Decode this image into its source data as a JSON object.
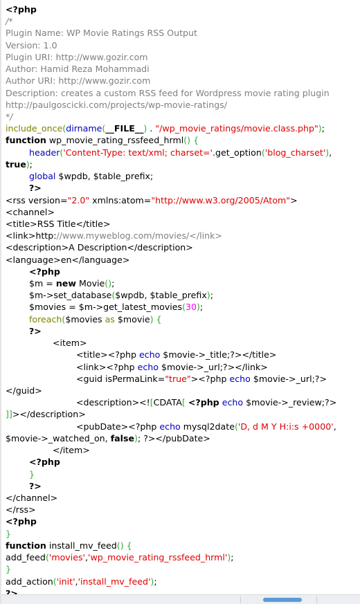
{
  "viewer": {
    "language": "php",
    "accent_color": "#5a9bd8",
    "background_color": "#ffffff",
    "scrollbar": {
      "orientation": "horizontal",
      "thumb_color": "#5a9bd8",
      "track_color": "#eceef1"
    }
  },
  "palette": {
    "default": "#000000",
    "comment": "#808080",
    "string": "#dd0000",
    "keyword": "#000000",
    "keyword_control": "#808000",
    "function": "#0000bb",
    "bracket": "#33aa33",
    "number": "#ff00ff"
  },
  "code": {
    "lines": [
      {
        "id": 1,
        "indent": 0,
        "tokens": [
          {
            "t": "<?php",
            "c": "kw"
          }
        ]
      },
      {
        "id": 2,
        "indent": 0,
        "tokens": [
          {
            "t": "/*",
            "c": "cmt-i"
          }
        ]
      },
      {
        "id": 3,
        "indent": 0,
        "tokens": [
          {
            "t": "Plugin Name: WP Movie Ratings RSS Output",
            "c": "cmt"
          }
        ]
      },
      {
        "id": 4,
        "indent": 0,
        "tokens": [
          {
            "t": "Version: 1.0",
            "c": "cmt"
          }
        ]
      },
      {
        "id": 5,
        "indent": 0,
        "tokens": [
          {
            "t": "Plugin URI: http://www.gozir.com",
            "c": "cmt"
          }
        ]
      },
      {
        "id": 6,
        "indent": 0,
        "tokens": [
          {
            "t": "Author: Hamid Reza Mohammadi",
            "c": "cmt"
          }
        ]
      },
      {
        "id": 7,
        "indent": 0,
        "tokens": [
          {
            "t": "Author URI: http://www.gozir.com",
            "c": "cmt"
          }
        ]
      },
      {
        "id": 8,
        "indent": 0,
        "tokens": [
          {
            "t": "Description: creates a custom RSS feed for Wordpress movie rating plugin",
            "c": "cmt"
          }
        ]
      },
      {
        "id": 9,
        "indent": 0,
        "tokens": [
          {
            "t": "http://paulgoscicki.com/projects/wp-movie-ratings/",
            "c": "cmt"
          }
        ]
      },
      {
        "id": 10,
        "indent": 0,
        "tokens": [
          {
            "t": "*/",
            "c": "cmt-i"
          }
        ]
      },
      {
        "id": 11,
        "indent": 0,
        "tokens": [
          {
            "t": "include_once",
            "c": "kw2"
          },
          {
            "t": "(",
            "c": "brk"
          },
          {
            "t": "dirname",
            "c": "fn"
          },
          {
            "t": "(",
            "c": "brk"
          },
          {
            "t": "__FILE__",
            "c": "kw"
          },
          {
            "t": ")",
            "c": "brk"
          },
          {
            "t": " . ",
            "c": "def"
          },
          {
            "t": "\"/wp_movie_ratings/movie.class.php\"",
            "c": "str"
          },
          {
            "t": ")",
            "c": "brk"
          },
          {
            "t": ";",
            "c": "def"
          }
        ]
      },
      {
        "id": 12,
        "indent": 0,
        "tokens": [
          {
            "t": "function",
            "c": "kw"
          },
          {
            "t": " wp_movie_rating_rssfeed_hrml",
            "c": "def"
          },
          {
            "t": "()",
            "c": "brk"
          },
          {
            "t": " ",
            "c": "def"
          },
          {
            "t": "{",
            "c": "brk"
          }
        ]
      },
      {
        "id": 13,
        "indent": 1,
        "tokens": [
          {
            "t": "header",
            "c": "fn"
          },
          {
            "t": "(",
            "c": "brk"
          },
          {
            "t": "'Content-Type: text/xml; charset='",
            "c": "str"
          },
          {
            "t": ".get_option",
            "c": "def"
          },
          {
            "t": "(",
            "c": "brk"
          },
          {
            "t": "'blog_charset'",
            "c": "str"
          },
          {
            "t": ")",
            "c": "brk"
          },
          {
            "t": ", ",
            "c": "def"
          },
          {
            "t": "true",
            "c": "kw"
          },
          {
            "t": ")",
            "c": "brk"
          },
          {
            "t": ";",
            "c": "def"
          }
        ]
      },
      {
        "id": 14,
        "indent": 1,
        "tokens": [
          {
            "t": "global",
            "c": "fn"
          },
          {
            "t": " $wpdb, $table_prefix;",
            "c": "def"
          }
        ]
      },
      {
        "id": 15,
        "indent": 1,
        "tokens": [
          {
            "t": "?>",
            "c": "kw"
          }
        ]
      },
      {
        "id": 16,
        "indent": 0,
        "tokens": [
          {
            "t": "<rss version=",
            "c": "def"
          },
          {
            "t": "\"2.0\"",
            "c": "str"
          },
          {
            "t": " xmlns:atom=",
            "c": "def"
          },
          {
            "t": "\"http://www.w3.org/2005/Atom\"",
            "c": "str"
          },
          {
            "t": ">",
            "c": "def"
          }
        ]
      },
      {
        "id": 17,
        "indent": 0,
        "tokens": [
          {
            "t": "<channel>",
            "c": "def"
          }
        ]
      },
      {
        "id": 18,
        "indent": 0,
        "tokens": [
          {
            "t": "<title>RSS Title</title>",
            "c": "def"
          }
        ]
      },
      {
        "id": 19,
        "indent": 0,
        "tokens": [
          {
            "t": "<link>http:",
            "c": "def"
          },
          {
            "t": "//www.myweblog.com/movies/</link>",
            "c": "cmt"
          }
        ]
      },
      {
        "id": 20,
        "indent": 0,
        "tokens": [
          {
            "t": "<description>A Description</description>",
            "c": "def"
          }
        ]
      },
      {
        "id": 21,
        "indent": 0,
        "tokens": [
          {
            "t": "<language>en</language>",
            "c": "def"
          }
        ]
      },
      {
        "id": 22,
        "indent": 1,
        "tokens": [
          {
            "t": "<?php",
            "c": "kw"
          }
        ]
      },
      {
        "id": 23,
        "indent": 1,
        "tokens": [
          {
            "t": "$m = ",
            "c": "def"
          },
          {
            "t": "new",
            "c": "kw"
          },
          {
            "t": " Movie",
            "c": "def"
          },
          {
            "t": "()",
            "c": "brk"
          },
          {
            "t": ";",
            "c": "def"
          }
        ]
      },
      {
        "id": 24,
        "indent": 1,
        "tokens": [
          {
            "t": "$m->set_database",
            "c": "def"
          },
          {
            "t": "(",
            "c": "brk"
          },
          {
            "t": "$wpdb, $table_prefix",
            "c": "def"
          },
          {
            "t": ")",
            "c": "brk"
          },
          {
            "t": ";",
            "c": "def"
          }
        ]
      },
      {
        "id": 25,
        "indent": 1,
        "tokens": [
          {
            "t": "$movies = $m->get_latest_movies",
            "c": "def"
          },
          {
            "t": "(",
            "c": "brk"
          },
          {
            "t": "30",
            "c": "num"
          },
          {
            "t": ")",
            "c": "brk"
          },
          {
            "t": ";",
            "c": "def"
          }
        ]
      },
      {
        "id": 26,
        "indent": 1,
        "tokens": [
          {
            "t": "foreach",
            "c": "kw2"
          },
          {
            "t": "(",
            "c": "brk"
          },
          {
            "t": "$movies ",
            "c": "def"
          },
          {
            "t": "as",
            "c": "kw2"
          },
          {
            "t": " $movie",
            "c": "def"
          },
          {
            "t": ")",
            "c": "brk"
          },
          {
            "t": " ",
            "c": "def"
          },
          {
            "t": "{",
            "c": "brk"
          }
        ]
      },
      {
        "id": 27,
        "indent": 1,
        "tokens": [
          {
            "t": "?>",
            "c": "kw"
          }
        ]
      },
      {
        "id": 28,
        "indent": 2,
        "tokens": [
          {
            "t": "<item>",
            "c": "def"
          }
        ]
      },
      {
        "id": 29,
        "indent": 3,
        "tokens": [
          {
            "t": "<title><?php ",
            "c": "def"
          },
          {
            "t": "echo",
            "c": "fn"
          },
          {
            "t": " $movie->_title;?></title>",
            "c": "def"
          }
        ]
      },
      {
        "id": 30,
        "indent": 3,
        "tokens": [
          {
            "t": "<link><?php ",
            "c": "def"
          },
          {
            "t": "echo",
            "c": "fn"
          },
          {
            "t": " $movie->_url;?></link>",
            "c": "def"
          }
        ]
      },
      {
        "id": 31,
        "indent": 3,
        "tokens": [
          {
            "t": "<guid isPermaLink=",
            "c": "def"
          },
          {
            "t": "\"true\"",
            "c": "str"
          },
          {
            "t": "><?php ",
            "c": "def"
          },
          {
            "t": "echo",
            "c": "fn"
          },
          {
            "t": " $movie->_url;?></guid>",
            "c": "def"
          }
        ]
      },
      {
        "id": 32,
        "indent": 3,
        "tokens": [
          {
            "t": "<description><!",
            "c": "def"
          },
          {
            "t": "[",
            "c": "brk"
          },
          {
            "t": "CDATA",
            "c": "def"
          },
          {
            "t": "[",
            "c": "brk"
          },
          {
            "t": " ",
            "c": "def"
          },
          {
            "t": "<?php",
            "c": "kw"
          },
          {
            "t": " ",
            "c": "def"
          },
          {
            "t": "echo",
            "c": "fn"
          },
          {
            "t": " $movie->_review;?>",
            "c": "def"
          },
          {
            "t": "\n",
            "c": "def"
          },
          {
            "t": "]]",
            "c": "brk"
          },
          {
            "t": "></description>",
            "c": "def"
          }
        ]
      },
      {
        "id": 33,
        "indent": 3,
        "tokens": [
          {
            "t": "<pubDate><?php ",
            "c": "def"
          },
          {
            "t": "echo",
            "c": "fn"
          },
          {
            "t": " mysql2date",
            "c": "def"
          },
          {
            "t": "(",
            "c": "brk"
          },
          {
            "t": "'D, d M Y H:i:s +0000'",
            "c": "str"
          },
          {
            "t": ", \n$movie->_watched_on, ",
            "c": "def"
          },
          {
            "t": "false",
            "c": "kw"
          },
          {
            "t": ")",
            "c": "brk"
          },
          {
            "t": "; ?></pubDate>",
            "c": "def"
          }
        ]
      },
      {
        "id": 34,
        "indent": 2,
        "tokens": [
          {
            "t": "</item>",
            "c": "def"
          }
        ]
      },
      {
        "id": 35,
        "indent": 1,
        "tokens": [
          {
            "t": "<?php",
            "c": "kw"
          }
        ]
      },
      {
        "id": 36,
        "indent": 1,
        "tokens": [
          {
            "t": "}",
            "c": "brk"
          }
        ]
      },
      {
        "id": 37,
        "indent": 1,
        "tokens": [
          {
            "t": "?>",
            "c": "kw"
          }
        ]
      },
      {
        "id": 38,
        "indent": 0,
        "tokens": [
          {
            "t": "</channel>",
            "c": "def"
          }
        ]
      },
      {
        "id": 39,
        "indent": 0,
        "tokens": [
          {
            "t": "</rss>",
            "c": "def"
          }
        ]
      },
      {
        "id": 40,
        "indent": 0,
        "tokens": [
          {
            "t": "<?php",
            "c": "kw"
          }
        ]
      },
      {
        "id": 41,
        "indent": 0,
        "tokens": [
          {
            "t": "}",
            "c": "brk"
          }
        ]
      },
      {
        "id": 42,
        "indent": 0,
        "tokens": [
          {
            "t": "function",
            "c": "kw"
          },
          {
            "t": " install_mv_feed",
            "c": "def"
          },
          {
            "t": "()",
            "c": "brk"
          },
          {
            "t": " ",
            "c": "def"
          },
          {
            "t": "{",
            "c": "brk"
          }
        ]
      },
      {
        "id": 43,
        "indent": 0,
        "tokens": [
          {
            "t": "add_feed",
            "c": "def"
          },
          {
            "t": "(",
            "c": "brk"
          },
          {
            "t": "'movies'",
            "c": "str"
          },
          {
            "t": ",",
            "c": "def"
          },
          {
            "t": "'wp_movie_rating_rssfeed_hrml'",
            "c": "str"
          },
          {
            "t": ")",
            "c": "brk"
          },
          {
            "t": ";",
            "c": "def"
          }
        ]
      },
      {
        "id": 44,
        "indent": 0,
        "tokens": [
          {
            "t": "}",
            "c": "brk"
          }
        ]
      },
      {
        "id": 45,
        "indent": 0,
        "tokens": [
          {
            "t": "add_action",
            "c": "def"
          },
          {
            "t": "(",
            "c": "brk"
          },
          {
            "t": "'init'",
            "c": "str"
          },
          {
            "t": ",",
            "c": "def"
          },
          {
            "t": "'install_mv_feed'",
            "c": "str"
          },
          {
            "t": ")",
            "c": "brk"
          },
          {
            "t": ";",
            "c": "def"
          }
        ]
      },
      {
        "id": 46,
        "indent": 0,
        "tokens": [
          {
            "t": "?>",
            "c": "kw"
          }
        ]
      }
    ]
  }
}
